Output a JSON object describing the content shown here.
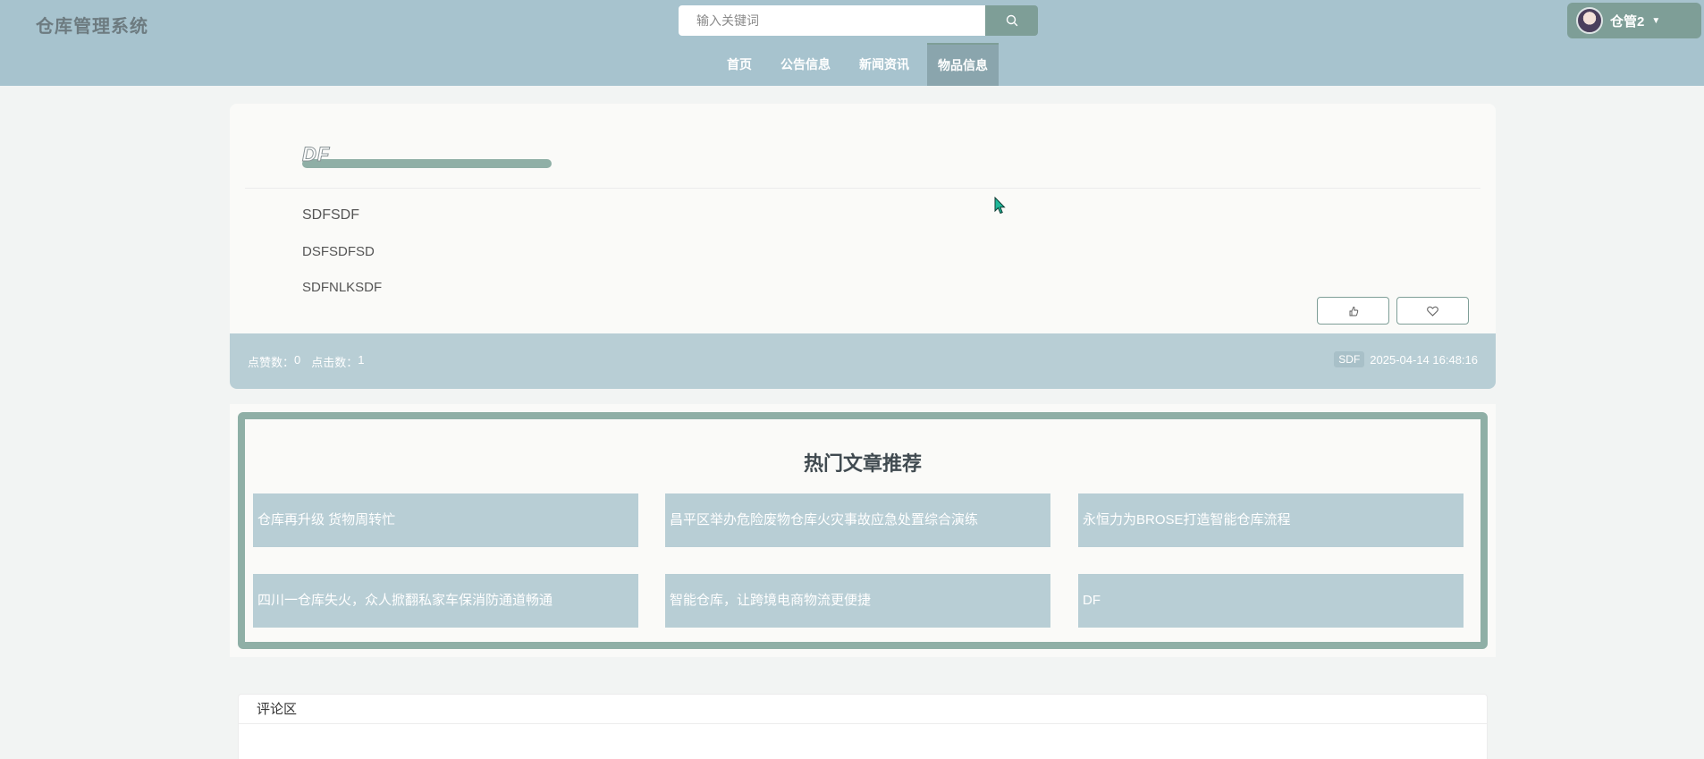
{
  "header": {
    "brand": "仓库管理系统",
    "search": {
      "placeholder": "输入关键词"
    },
    "nav": [
      "首页",
      "公告信息",
      "新闻资讯",
      "物品信息"
    ],
    "active_nav": "物品信息",
    "user": {
      "name": "仓管2"
    }
  },
  "article": {
    "title": "DF",
    "lines": [
      "SDFSDF",
      "DSFSDFSD",
      "SDFNLKSDF"
    ],
    "stats": {
      "likes_label": "点赞数：",
      "likes": "0",
      "clicks_label": "点击数：",
      "clicks": "1"
    },
    "author": "SDF",
    "datetime": "2025-04-14 16:48:16"
  },
  "hot": {
    "title": "热门文章推荐",
    "items": [
      "仓库再升级 货物周转忙",
      "昌平区举办危险废物仓库火灾事故应急处置综合演练",
      "永恒力为BROSE打造智能仓库流程",
      "四川一仓库失火，众人掀翻私家车保消防通道畅通",
      "智能仓库，让跨境电商物流更便捷",
      "DF"
    ]
  },
  "comments": {
    "title": "评论区"
  },
  "colors": {
    "header_bg": "#a7c3ce",
    "accent": "#7e9e97",
    "card_strip": "#b8ced5"
  }
}
